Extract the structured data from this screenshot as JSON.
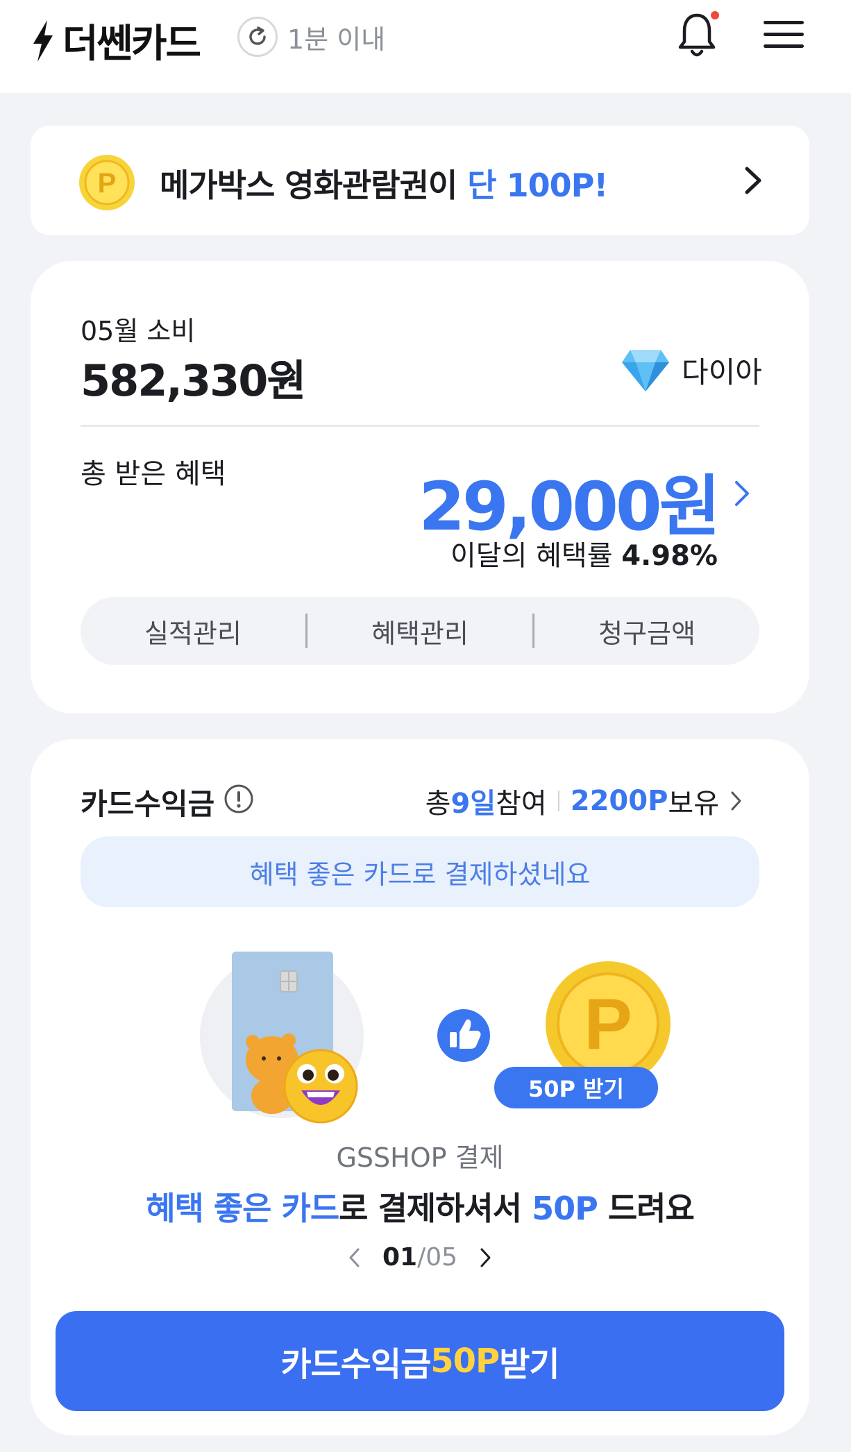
{
  "header": {
    "logo_text": "더쎈카드",
    "refresh_text": "1분 이내"
  },
  "promo": {
    "text_main": "메가박스 영화관람권이 ",
    "text_highlight": "단 100P!"
  },
  "summary": {
    "month_label": "05월 소비",
    "month_amount": "582,330원",
    "grade": "다이아",
    "benefit_label": "총 받은 혜택",
    "benefit_amount": "29,000원",
    "rate_label": "이달의 혜택률 ",
    "rate_value": "4.98%",
    "tabs": [
      {
        "label": "실적관리"
      },
      {
        "label": "혜택관리"
      },
      {
        "label": "청구금액"
      }
    ]
  },
  "earn": {
    "title": "카드수익금",
    "stats_prefix": "총 ",
    "stats_days": "9일",
    "stats_mid": " 참여",
    "stats_points": "2200P",
    "stats_suffix": " 보유",
    "message": "혜택 좋은 카드로 결제하셨네요",
    "reward_badge": "50P 받기",
    "caption_sub": "GSSHOP 결제",
    "caption_blue1": "혜택 좋은 카드",
    "caption_plain1": "로 결제하셔서 ",
    "caption_blue2": "50P",
    "caption_plain2": " 드려요",
    "page_current": "01",
    "page_sep": " / ",
    "page_total": "05",
    "cta_prefix": "카드수익금 ",
    "cta_gold": "50P",
    "cta_suffix": " 받기"
  },
  "colors": {
    "accent": "#3a76f0",
    "cta": "#3a6ff2",
    "gold": "#ffd23e",
    "background": "#f2f3f6"
  },
  "icons": [
    "bolt-icon",
    "refresh-icon",
    "bell-icon",
    "menu-icon",
    "coin-icon",
    "chevron-right-icon",
    "diamond-icon",
    "info-icon",
    "thumbs-up-icon",
    "chevron-left-icon"
  ]
}
